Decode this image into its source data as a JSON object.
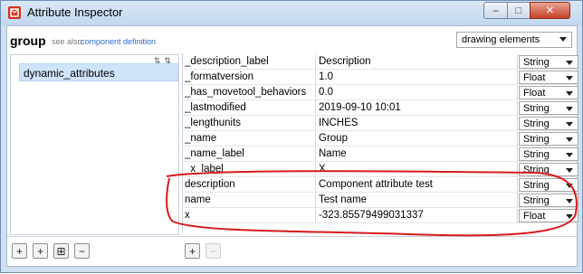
{
  "window": {
    "title": "Attribute Inspector",
    "buttons": {
      "minimize": "–",
      "maximize": "□",
      "close": "✕"
    }
  },
  "header": {
    "title": "group",
    "see_also": "see also:",
    "link": "component definition",
    "dropdown_value": "drawing elements"
  },
  "dictionaries": [
    "dynamic_attributes"
  ],
  "attributes": [
    {
      "name": "_description_label",
      "value": "Description",
      "type": "String"
    },
    {
      "name": "_formatversion",
      "value": "1.0",
      "type": "Float"
    },
    {
      "name": "_has_movetool_behaviors",
      "value": "0.0",
      "type": "Float"
    },
    {
      "name": "_lastmodified",
      "value": "2019-09-10 10:01",
      "type": "String"
    },
    {
      "name": "_lengthunits",
      "value": "INCHES",
      "type": "String"
    },
    {
      "name": "_name",
      "value": "Group",
      "type": "String"
    },
    {
      "name": "_name_label",
      "value": "Name",
      "type": "String"
    },
    {
      "name": "_x_label",
      "value": "X",
      "type": "String"
    },
    {
      "name": "description",
      "value": "Component attribute test",
      "type": "String"
    },
    {
      "name": "name",
      "value": "Test name",
      "type": "String"
    },
    {
      "name": "x",
      "value": "-323.85579499031337",
      "type": "Float"
    }
  ],
  "footer_left": [
    "+",
    "+",
    "⊞",
    "−"
  ],
  "footer_right": [
    "+",
    "−"
  ],
  "annotation_color": "#d81a1a"
}
